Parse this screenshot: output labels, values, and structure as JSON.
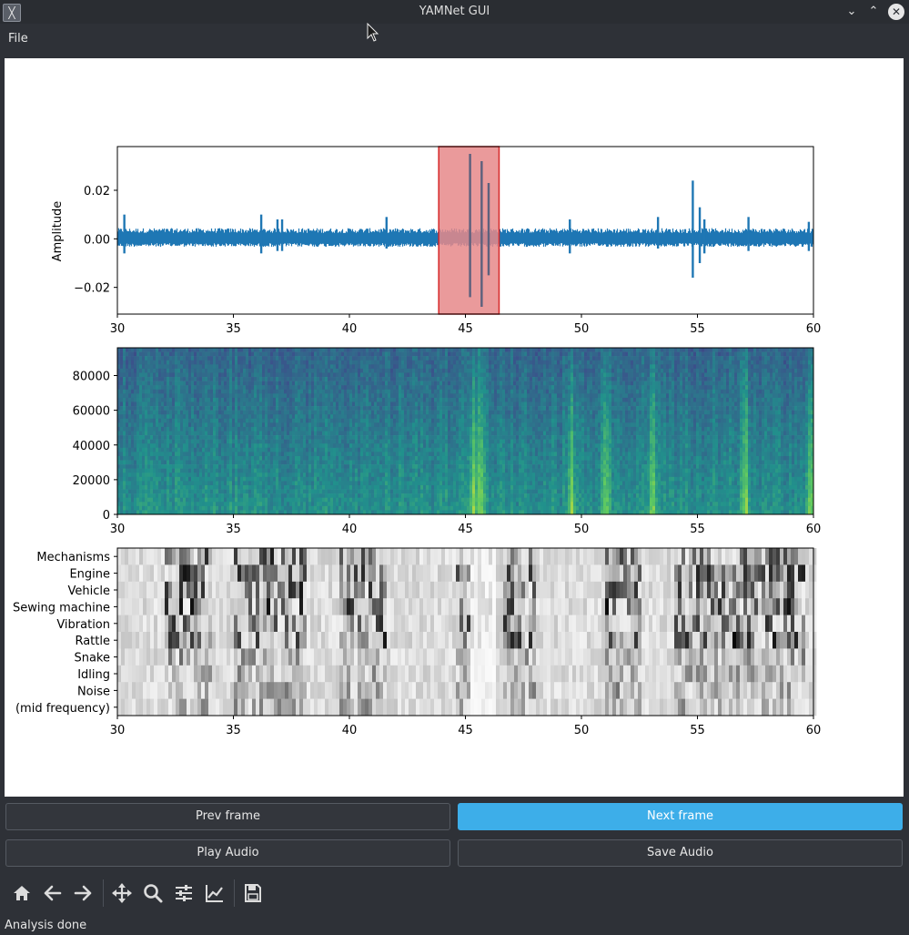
{
  "window": {
    "title": "YAMNet GUI"
  },
  "menu": {
    "file": "File"
  },
  "buttons": {
    "prev": "Prev frame",
    "next": "Next frame",
    "play": "Play Audio",
    "save": "Save Audio"
  },
  "status": "Analysis done",
  "toolbar_icons": [
    "home-icon",
    "back-icon",
    "forward-icon",
    "pan-icon",
    "zoom-icon",
    "configure-subplots-icon",
    "edit-axis-icon",
    "save-figure-icon"
  ],
  "colors": {
    "accent": "#3daee9",
    "waveform": "#1f77b4",
    "selection_fill": "#e6888a",
    "selection_edge": "#d62728"
  },
  "chart_data": [
    {
      "type": "line",
      "name": "waveform",
      "ylabel": "Amplitude",
      "xlim": [
        30,
        60
      ],
      "ylim": [
        -0.031,
        0.038
      ],
      "xticks": [
        "30",
        "35",
        "40",
        "45",
        "50",
        "55",
        "60"
      ],
      "yticks": [
        "0.02",
        "0.00",
        "−0.02"
      ],
      "ytick_values": [
        0.02,
        0.0,
        -0.02
      ],
      "noise_band": [
        -0.003,
        0.004
      ],
      "spikes": [
        {
          "x": 30.3,
          "y": [
            -0.006,
            0.01
          ]
        },
        {
          "x": 36.2,
          "y": [
            -0.006,
            0.01
          ]
        },
        {
          "x": 36.9,
          "y": [
            -0.005,
            0.008
          ]
        },
        {
          "x": 37.1,
          "y": [
            -0.005,
            0.008
          ]
        },
        {
          "x": 41.6,
          "y": [
            -0.004,
            0.009
          ]
        },
        {
          "x": 45.2,
          "y": [
            -0.024,
            0.035
          ]
        },
        {
          "x": 45.7,
          "y": [
            -0.028,
            0.032
          ]
        },
        {
          "x": 46.0,
          "y": [
            -0.015,
            0.023
          ]
        },
        {
          "x": 49.5,
          "y": [
            -0.006,
            0.008
          ]
        },
        {
          "x": 53.3,
          "y": [
            -0.004,
            0.009
          ]
        },
        {
          "x": 54.8,
          "y": [
            -0.016,
            0.024
          ]
        },
        {
          "x": 55.1,
          "y": [
            -0.01,
            0.013
          ]
        },
        {
          "x": 55.3,
          "y": [
            -0.006,
            0.008
          ]
        },
        {
          "x": 57.2,
          "y": [
            -0.005,
            0.009
          ]
        },
        {
          "x": 59.8,
          "y": [
            -0.005,
            0.007
          ]
        }
      ],
      "selection": [
        43.85,
        46.45
      ]
    },
    {
      "type": "heatmap",
      "name": "spectrogram",
      "xlim": [
        30,
        60
      ],
      "ylim": [
        0,
        96000
      ],
      "xticks": [
        "30",
        "35",
        "40",
        "45",
        "50",
        "55",
        "60"
      ],
      "yticks": [
        "80000",
        "60000",
        "40000",
        "20000",
        "0"
      ],
      "ytick_values": [
        80000,
        60000,
        40000,
        20000,
        0
      ],
      "colormap": "viridis",
      "bright_times": [
        45.3,
        45.6,
        49.5,
        51.0,
        53.0,
        57.0,
        59.8
      ]
    },
    {
      "type": "heatmap",
      "name": "class-scores",
      "xlim": [
        30,
        60
      ],
      "xticks": [
        "30",
        "35",
        "40",
        "45",
        "50",
        "55",
        "60"
      ],
      "categories": [
        "Mechanisms",
        "Engine",
        "Vehicle",
        "Sewing machine",
        "Vibration",
        "Rattle",
        "Snake",
        "Idling",
        "Noise",
        "(mid frequency)"
      ],
      "colormap": "gray_r"
    }
  ]
}
